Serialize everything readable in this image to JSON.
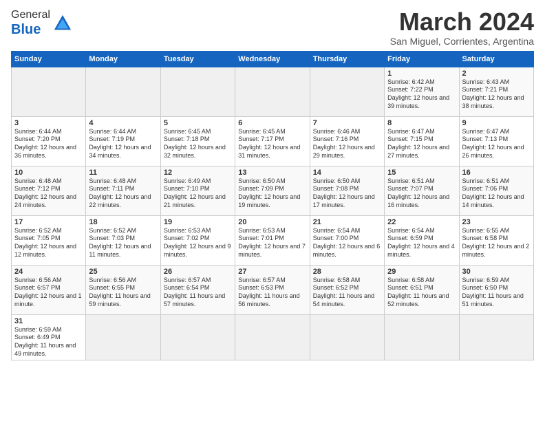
{
  "logo": {
    "text_general": "General",
    "text_blue": "Blue"
  },
  "title": "March 2024",
  "subtitle": "San Miguel, Corrientes, Argentina",
  "days_header": [
    "Sunday",
    "Monday",
    "Tuesday",
    "Wednesday",
    "Thursday",
    "Friday",
    "Saturday"
  ],
  "weeks": [
    [
      {
        "num": "",
        "content": ""
      },
      {
        "num": "",
        "content": ""
      },
      {
        "num": "",
        "content": ""
      },
      {
        "num": "",
        "content": ""
      },
      {
        "num": "",
        "content": ""
      },
      {
        "num": "1",
        "content": "Sunrise: 6:42 AM\nSunset: 7:22 PM\nDaylight: 12 hours and 39 minutes."
      },
      {
        "num": "2",
        "content": "Sunrise: 6:43 AM\nSunset: 7:21 PM\nDaylight: 12 hours and 38 minutes."
      }
    ],
    [
      {
        "num": "3",
        "content": "Sunrise: 6:44 AM\nSunset: 7:20 PM\nDaylight: 12 hours and 36 minutes."
      },
      {
        "num": "4",
        "content": "Sunrise: 6:44 AM\nSunset: 7:19 PM\nDaylight: 12 hours and 34 minutes."
      },
      {
        "num": "5",
        "content": "Sunrise: 6:45 AM\nSunset: 7:18 PM\nDaylight: 12 hours and 32 minutes."
      },
      {
        "num": "6",
        "content": "Sunrise: 6:45 AM\nSunset: 7:17 PM\nDaylight: 12 hours and 31 minutes."
      },
      {
        "num": "7",
        "content": "Sunrise: 6:46 AM\nSunset: 7:16 PM\nDaylight: 12 hours and 29 minutes."
      },
      {
        "num": "8",
        "content": "Sunrise: 6:47 AM\nSunset: 7:15 PM\nDaylight: 12 hours and 27 minutes."
      },
      {
        "num": "9",
        "content": "Sunrise: 6:47 AM\nSunset: 7:13 PM\nDaylight: 12 hours and 26 minutes."
      }
    ],
    [
      {
        "num": "10",
        "content": "Sunrise: 6:48 AM\nSunset: 7:12 PM\nDaylight: 12 hours and 24 minutes."
      },
      {
        "num": "11",
        "content": "Sunrise: 6:48 AM\nSunset: 7:11 PM\nDaylight: 12 hours and 22 minutes."
      },
      {
        "num": "12",
        "content": "Sunrise: 6:49 AM\nSunset: 7:10 PM\nDaylight: 12 hours and 21 minutes."
      },
      {
        "num": "13",
        "content": "Sunrise: 6:50 AM\nSunset: 7:09 PM\nDaylight: 12 hours and 19 minutes."
      },
      {
        "num": "14",
        "content": "Sunrise: 6:50 AM\nSunset: 7:08 PM\nDaylight: 12 hours and 17 minutes."
      },
      {
        "num": "15",
        "content": "Sunrise: 6:51 AM\nSunset: 7:07 PM\nDaylight: 12 hours and 16 minutes."
      },
      {
        "num": "16",
        "content": "Sunrise: 6:51 AM\nSunset: 7:06 PM\nDaylight: 12 hours and 14 minutes."
      }
    ],
    [
      {
        "num": "17",
        "content": "Sunrise: 6:52 AM\nSunset: 7:05 PM\nDaylight: 12 hours and 12 minutes."
      },
      {
        "num": "18",
        "content": "Sunrise: 6:52 AM\nSunset: 7:03 PM\nDaylight: 12 hours and 11 minutes."
      },
      {
        "num": "19",
        "content": "Sunrise: 6:53 AM\nSunset: 7:02 PM\nDaylight: 12 hours and 9 minutes."
      },
      {
        "num": "20",
        "content": "Sunrise: 6:53 AM\nSunset: 7:01 PM\nDaylight: 12 hours and 7 minutes."
      },
      {
        "num": "21",
        "content": "Sunrise: 6:54 AM\nSunset: 7:00 PM\nDaylight: 12 hours and 6 minutes."
      },
      {
        "num": "22",
        "content": "Sunrise: 6:54 AM\nSunset: 6:59 PM\nDaylight: 12 hours and 4 minutes."
      },
      {
        "num": "23",
        "content": "Sunrise: 6:55 AM\nSunset: 6:58 PM\nDaylight: 12 hours and 2 minutes."
      }
    ],
    [
      {
        "num": "24",
        "content": "Sunrise: 6:56 AM\nSunset: 6:57 PM\nDaylight: 12 hours and 1 minute."
      },
      {
        "num": "25",
        "content": "Sunrise: 6:56 AM\nSunset: 6:55 PM\nDaylight: 11 hours and 59 minutes."
      },
      {
        "num": "26",
        "content": "Sunrise: 6:57 AM\nSunset: 6:54 PM\nDaylight: 11 hours and 57 minutes."
      },
      {
        "num": "27",
        "content": "Sunrise: 6:57 AM\nSunset: 6:53 PM\nDaylight: 11 hours and 56 minutes."
      },
      {
        "num": "28",
        "content": "Sunrise: 6:58 AM\nSunset: 6:52 PM\nDaylight: 11 hours and 54 minutes."
      },
      {
        "num": "29",
        "content": "Sunrise: 6:58 AM\nSunset: 6:51 PM\nDaylight: 11 hours and 52 minutes."
      },
      {
        "num": "30",
        "content": "Sunrise: 6:59 AM\nSunset: 6:50 PM\nDaylight: 11 hours and 51 minutes."
      }
    ],
    [
      {
        "num": "31",
        "content": "Sunrise: 6:59 AM\nSunset: 6:49 PM\nDaylight: 11 hours and 49 minutes."
      },
      {
        "num": "",
        "content": ""
      },
      {
        "num": "",
        "content": ""
      },
      {
        "num": "",
        "content": ""
      },
      {
        "num": "",
        "content": ""
      },
      {
        "num": "",
        "content": ""
      },
      {
        "num": "",
        "content": ""
      }
    ]
  ]
}
